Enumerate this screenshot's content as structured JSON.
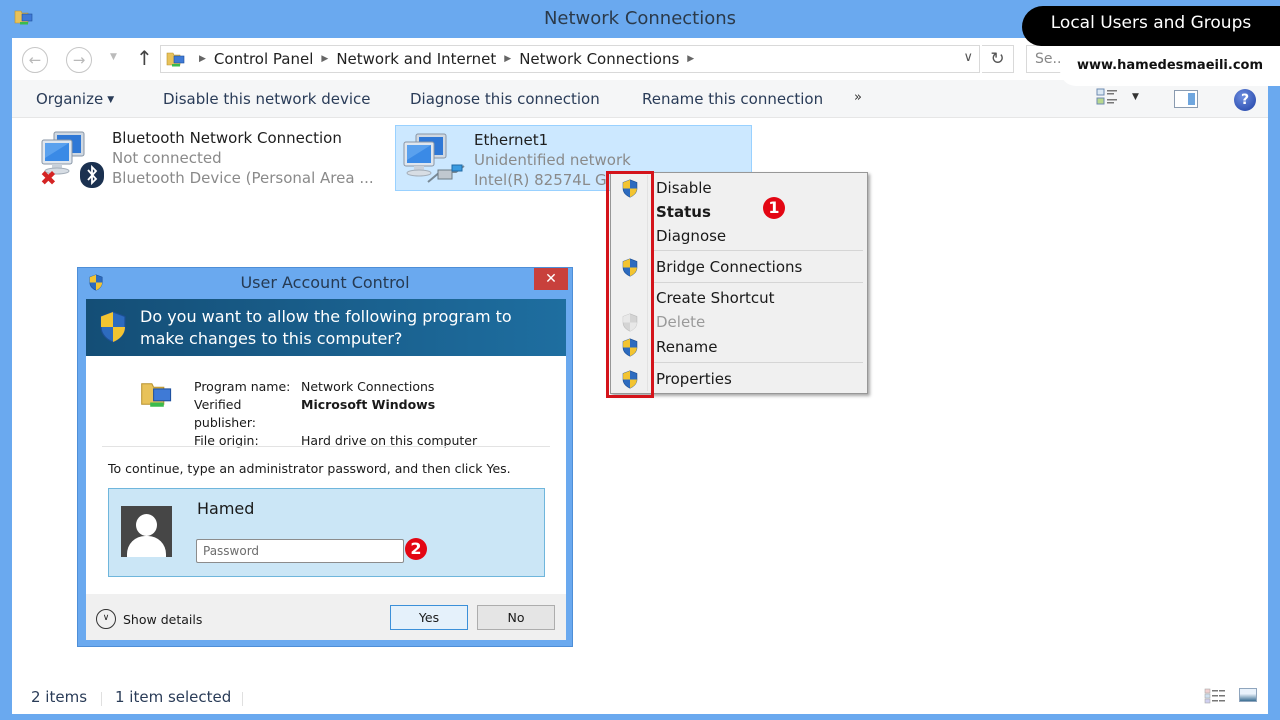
{
  "window": {
    "title": "Network Connections"
  },
  "address_bar": {
    "crumbs": [
      "Control Panel",
      "Network and Internet",
      "Network Connections"
    ],
    "search_placeholder": "Se..."
  },
  "toolbar": {
    "organize": "Organize",
    "disable": "Disable this network device",
    "diagnose": "Diagnose this connection",
    "rename": "Rename this connection",
    "more": "»"
  },
  "connections": [
    {
      "name": "Bluetooth Network Connection",
      "status": "Not connected",
      "device": "Bluetooth Device (Personal Area ..."
    },
    {
      "name": "Ethernet1",
      "status": "Unidentified network",
      "device": "Intel(R) 82574L G"
    }
  ],
  "context_menu": {
    "items": [
      {
        "label": "Disable",
        "icon": "uac-shield-icon",
        "state": "normal"
      },
      {
        "label": "Status",
        "icon": null,
        "state": "default"
      },
      {
        "label": "Diagnose",
        "icon": null,
        "state": "normal"
      },
      {
        "label": "Bridge Connections",
        "icon": "uac-shield-icon",
        "state": "normal"
      },
      {
        "label": "Create Shortcut",
        "icon": null,
        "state": "normal"
      },
      {
        "label": "Delete",
        "icon": "uac-shield-icon",
        "state": "disabled"
      },
      {
        "label": "Rename",
        "icon": "uac-shield-icon",
        "state": "normal"
      },
      {
        "label": "Properties",
        "icon": "uac-shield-icon",
        "state": "normal"
      }
    ],
    "badge": "1"
  },
  "uac": {
    "title": "User Account Control",
    "close": "✕",
    "question": "Do you want to allow the following program to make changes to this computer?",
    "program_label": "Program name:",
    "program_value": "Network Connections",
    "publisher_label": "Verified publisher:",
    "publisher_value": "Microsoft Windows",
    "origin_label": "File origin:",
    "origin_value": "Hard drive on this computer",
    "prompt": "To continue, type an administrator password, and then click Yes.",
    "username": "Hamed",
    "password_placeholder": "Password",
    "password_value": "",
    "badge": "2",
    "show_details": "Show details",
    "yes": "Yes",
    "no": "No"
  },
  "status_bar": {
    "count": "2 items",
    "selected": "1 item selected"
  },
  "watermark": {
    "title": "Local Users and Groups",
    "url": "www.hamedesmaeili.com"
  },
  "colors": {
    "frame": "#6aa9ef",
    "selection": "#cce8ff",
    "uac_header": "#144e76",
    "highlight": "#d4141b",
    "badge": "#e30613"
  }
}
